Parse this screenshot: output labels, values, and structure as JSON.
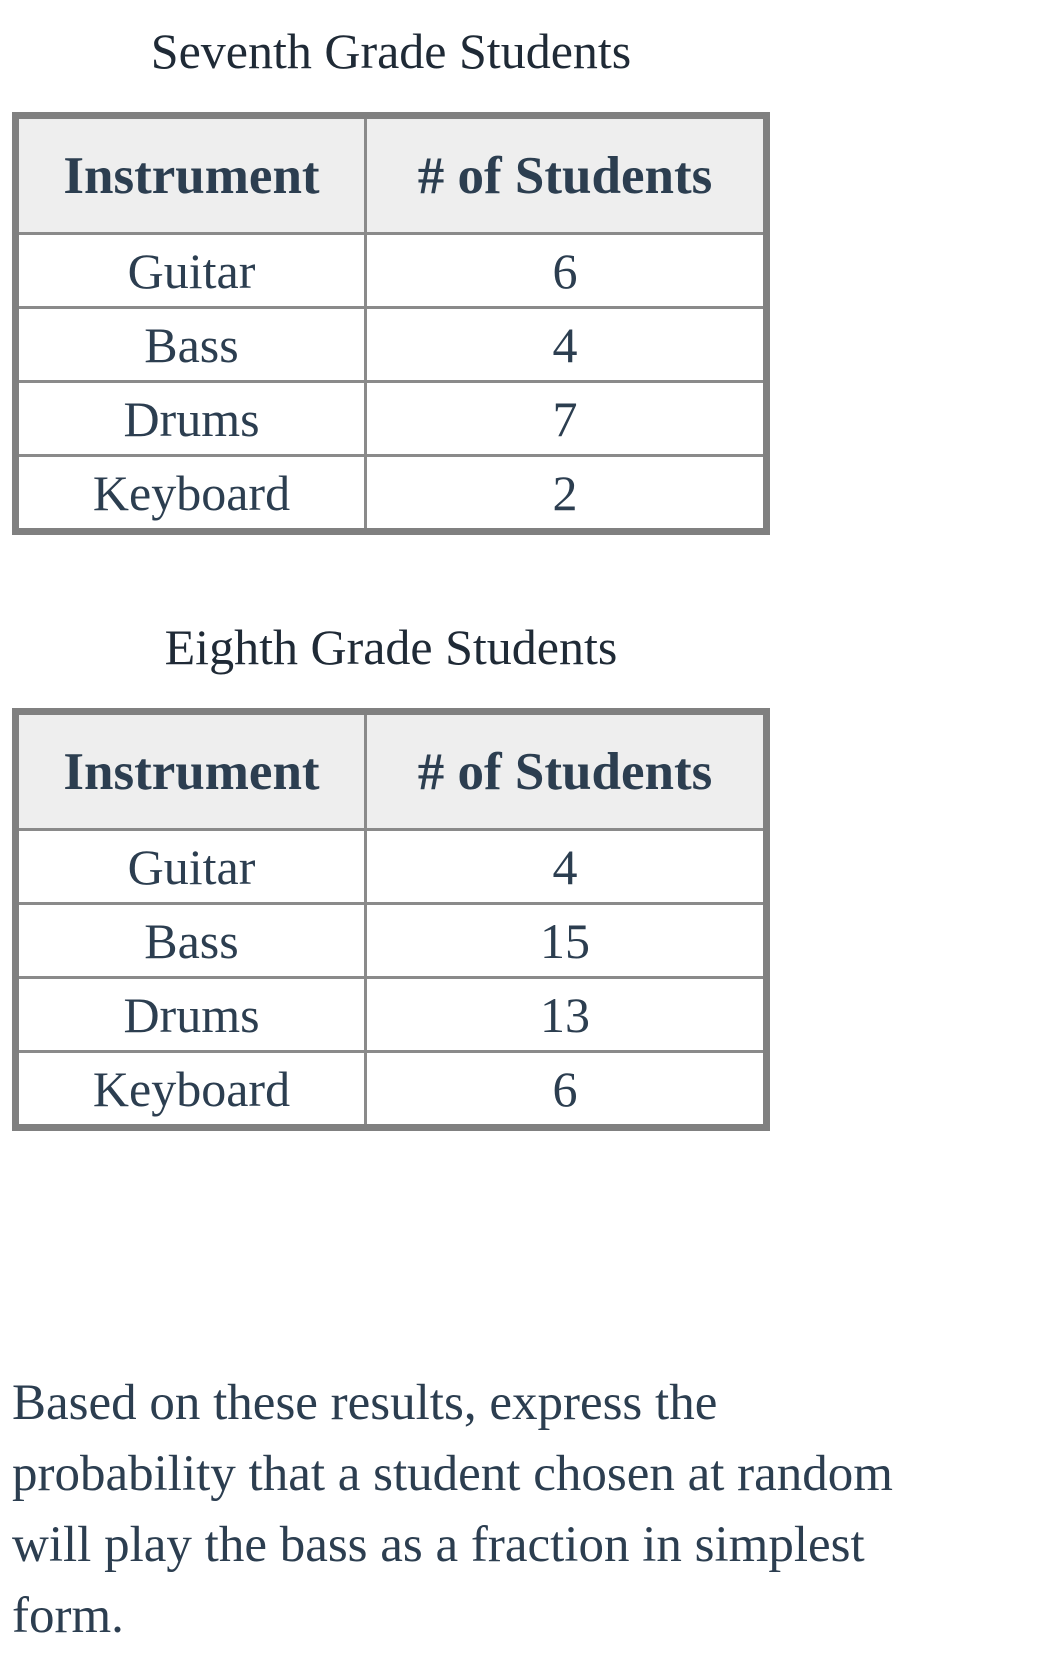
{
  "tables": [
    {
      "title": "Seventh Grade Students",
      "headers": [
        "Instrument",
        "# of Students"
      ],
      "rows": [
        [
          "Guitar",
          "6"
        ],
        [
          "Bass",
          "4"
        ],
        [
          "Drums",
          "7"
        ],
        [
          "Keyboard",
          "2"
        ]
      ]
    },
    {
      "title": "Eighth Grade Students",
      "headers": [
        "Instrument",
        "# of Students"
      ],
      "rows": [
        [
          "Guitar",
          "4"
        ],
        [
          "Bass",
          "15"
        ],
        [
          "Drums",
          "13"
        ],
        [
          "Keyboard",
          "6"
        ]
      ]
    }
  ],
  "question": {
    "lines": [
      "Based on these results, express the",
      "probability that a student chosen at random",
      "will play the bass as a fraction in simplest",
      "form."
    ]
  }
}
